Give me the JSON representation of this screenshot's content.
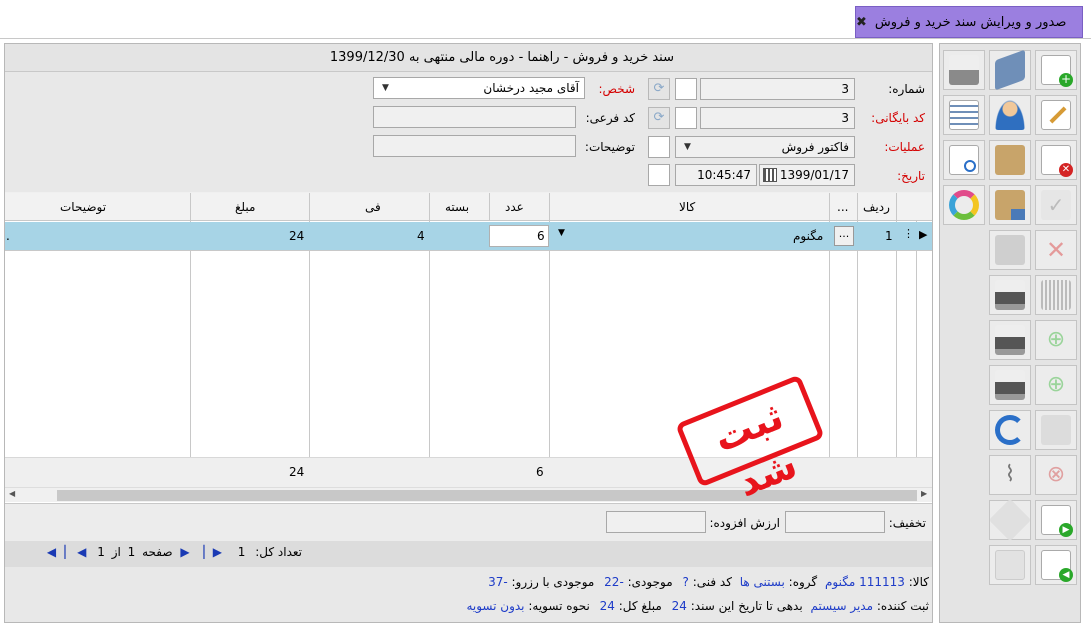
{
  "tab": {
    "title": "صدور و ویرایش سند خرید و فروش",
    "close": "✖"
  },
  "titlebar": {
    "text": "سند خرید و فروش  -  راهنما  -  دوره مالی منتهی به 1399/12/30"
  },
  "form": {
    "number_label": "شماره:",
    "number_value": "3",
    "archive_label": "کد بایگانی:",
    "archive_value": "3",
    "operation_label": "عملیات:",
    "operation_value": "فاکتور فروش",
    "date_label": "تاریخ:",
    "date_value": "1399/01/17",
    "time_value": "10:45:47",
    "person_label": "شخص:",
    "person_value": "آقای مجید درخشان",
    "subcode_label": "کد فرعی:",
    "desc_label": "توضیحات:"
  },
  "grid": {
    "headers": {
      "row": "ردیف",
      "more": "...",
      "item": "کالا",
      "count": "عدد",
      "pack": "بسته",
      "unit_price": "فی",
      "amount": "مبلغ",
      "desc": "توضیحات"
    },
    "rows": [
      {
        "row": "1",
        "item": "مگنوم",
        "count": "6",
        "pack": "",
        "unit_price": "4",
        "amount": "24",
        "desc": "."
      }
    ],
    "totals": {
      "count": "6",
      "amount": "24"
    },
    "ellipsis": "..."
  },
  "stamp": {
    "text": "ثبت شد",
    "color": "#e8141c"
  },
  "bottom": {
    "discount_label": "تخفیف:",
    "vat_label": "ارزش افزوده:"
  },
  "pager": {
    "total_label": "تعداد کل:",
    "total_value": "1",
    "page_label": "صفحه",
    "page_value": "1",
    "of_label": "از",
    "of_value": "1"
  },
  "info": {
    "item_label": "کالا:",
    "item_value": "111113 مگنوم",
    "group_label": "گروه:",
    "group_value": "بستنی ها",
    "tech_label": "کد فنی:",
    "tech_value": "?",
    "stock_label": "موجودی:",
    "stock_value": "-22",
    "reserved_label": "موجودی با رزرو:",
    "reserved_value": "-37",
    "registrar_label": "ثبت کننده:",
    "registrar_value": "مدیر سیستم",
    "debt_label": "بدهی تا تاریخ این سند:",
    "debt_value": "24",
    "total_label": "مبلغ کل:",
    "total_value": "24",
    "settle_label": "نحوه تسویه:",
    "settle_value": "بدون تسویه"
  },
  "colors": {
    "tab": "#9b7fe0",
    "selected_row": "#a7d4e6",
    "link": "#1e3cc8",
    "required_label": "#d40000"
  },
  "toolbar_icons": [
    "new-document-icon",
    "book-icon",
    "cash-register-icon",
    "edit-icon",
    "user-icon",
    "invoice-list-icon",
    "delete-document-icon",
    "package-icon",
    "search-document-icon",
    "confirm-icon",
    "package-computer-icon",
    "color-wheel-icon",
    "cancel-icon",
    "boxes-icon",
    "barcode-icon",
    "printer-icon",
    "add-icon",
    "numbered-printer-icon",
    "download-icon",
    "printer-check-icon",
    "grid-icon",
    "refresh-icon",
    "remove-icon",
    "paperclip-icon",
    "next-document-icon",
    "tag-icon",
    "previous-document-icon",
    "calculator-icon"
  ]
}
